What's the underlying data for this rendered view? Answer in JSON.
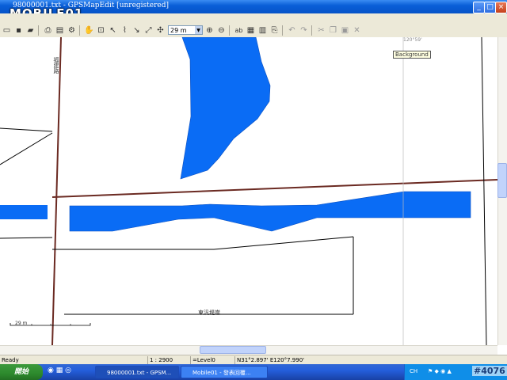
{
  "window": {
    "title": "98000001.txt - GPSMapEdit [unregistered]",
    "watermark": "MOBILE01"
  },
  "toolbar": {
    "zoom_value": "29 m",
    "icons": [
      "new-icon",
      "open-icon",
      "open-folder-icon",
      "save-icon",
      "print-icon",
      "properties-icon",
      "hand-icon",
      "zoom-rect-icon",
      "select-icon",
      "polyline-icon",
      "edit-node-icon",
      "move-icon",
      "zoom-in-icon",
      "zoom-out-icon",
      "label-icon",
      "grid-icon",
      "ruler-icon",
      "clip-icon",
      "undo-icon",
      "redo-icon",
      "cut-icon",
      "copy-icon",
      "paste-icon",
      "delete-icon"
    ]
  },
  "map": {
    "tooltip": "Background",
    "coord_top": "120°59'",
    "road_label_vertical": "福建路",
    "bottom_label": "東汎堤岸",
    "scale_label": "29 m",
    "colors": {
      "water": "#0a6cf5",
      "road": "#6b2a22",
      "line": "#000000"
    }
  },
  "statusbar": {
    "ready": "Ready",
    "scale": "1 : 2900",
    "level": "=Level0",
    "coords": "N31°2.897' E120°7.990'"
  },
  "taskbar": {
    "start_label": "開始",
    "items": [
      {
        "label": "98000001.txt - GPSM..."
      },
      {
        "label": "Mobile01 - 發表回覆..."
      }
    ],
    "tray_lang": "CH",
    "watermark": "#4076"
  }
}
